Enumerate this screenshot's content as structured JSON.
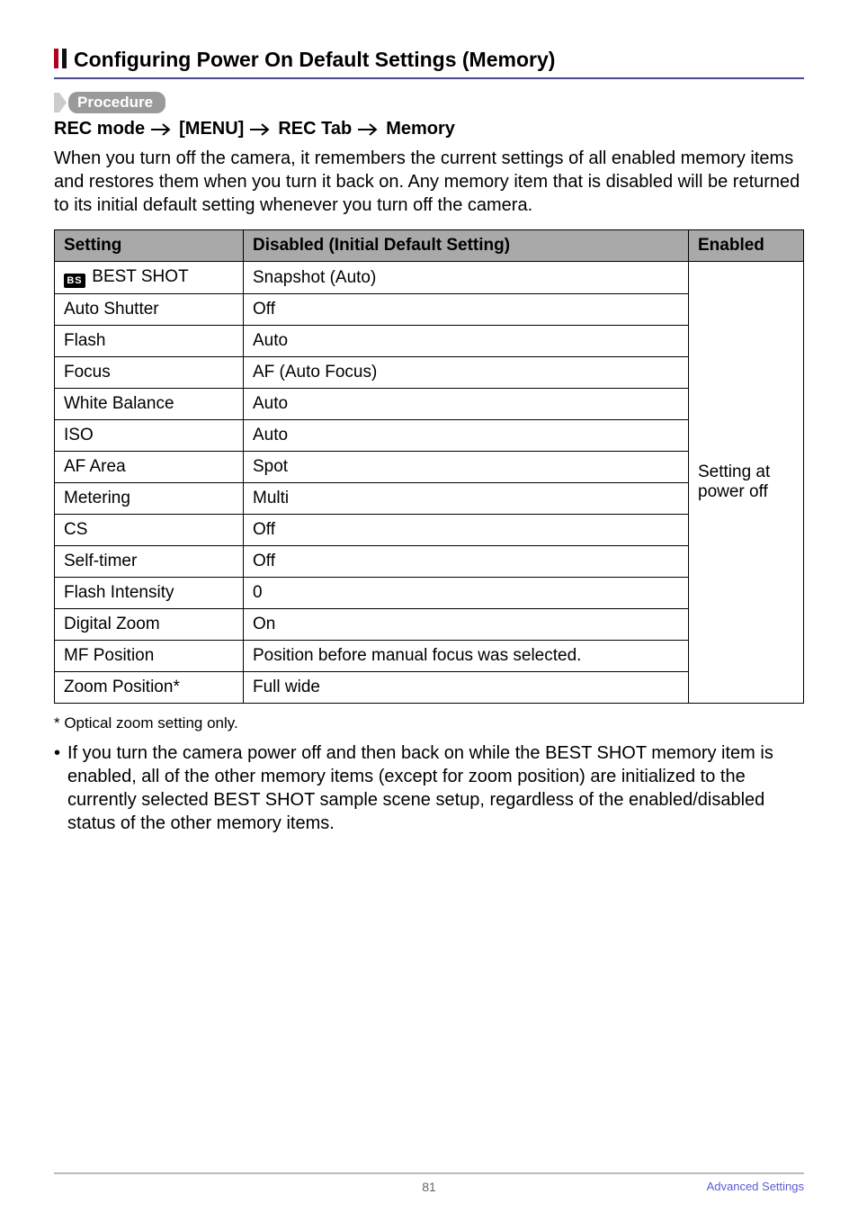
{
  "heading": "Configuring Power On Default Settings (Memory)",
  "procedure_label": "Procedure",
  "path": [
    "REC mode",
    "[MENU]",
    "REC Tab",
    "Memory"
  ],
  "intro": "When you turn off the camera, it remembers the current settings of all enabled memory items and restores them when you turn it back on. Any memory item that is disabled will be returned to its initial default setting whenever you turn off the camera.",
  "table": {
    "headers": {
      "setting": "Setting",
      "disabled": "Disabled (Initial Default Setting)",
      "enabled": "Enabled"
    },
    "rows": [
      {
        "setting": "BEST SHOT",
        "setting_icon": "BS",
        "disabled": "Snapshot (Auto)"
      },
      {
        "setting": "Auto Shutter",
        "disabled": "Off"
      },
      {
        "setting": "Flash",
        "disabled": "Auto"
      },
      {
        "setting": "Focus",
        "disabled": "AF (Auto Focus)"
      },
      {
        "setting": "White Balance",
        "disabled": "Auto"
      },
      {
        "setting": "ISO",
        "disabled": "Auto"
      },
      {
        "setting": "AF Area",
        "disabled": "Spot"
      },
      {
        "setting": "Metering",
        "disabled": "Multi"
      },
      {
        "setting": "CS",
        "disabled": "Off"
      },
      {
        "setting": "Self-timer",
        "disabled": "Off"
      },
      {
        "setting": "Flash Intensity",
        "disabled": "0"
      },
      {
        "setting": "Digital Zoom",
        "disabled": "On"
      },
      {
        "setting": "MF Position",
        "disabled": "Position before manual focus was selected."
      },
      {
        "setting": "Zoom Position*",
        "disabled": "Full wide"
      }
    ],
    "enabled_text": "Setting at power off"
  },
  "footnote": "* Optical zoom setting only.",
  "bullet": "If you turn the camera power off and then back on while the BEST SHOT memory item is enabled, all of the other memory items (except for zoom position) are initialized to the currently selected BEST SHOT sample scene setup, regardless of the enabled/disabled status of the other memory items.",
  "footer": {
    "page": "81",
    "section": "Advanced Settings"
  }
}
